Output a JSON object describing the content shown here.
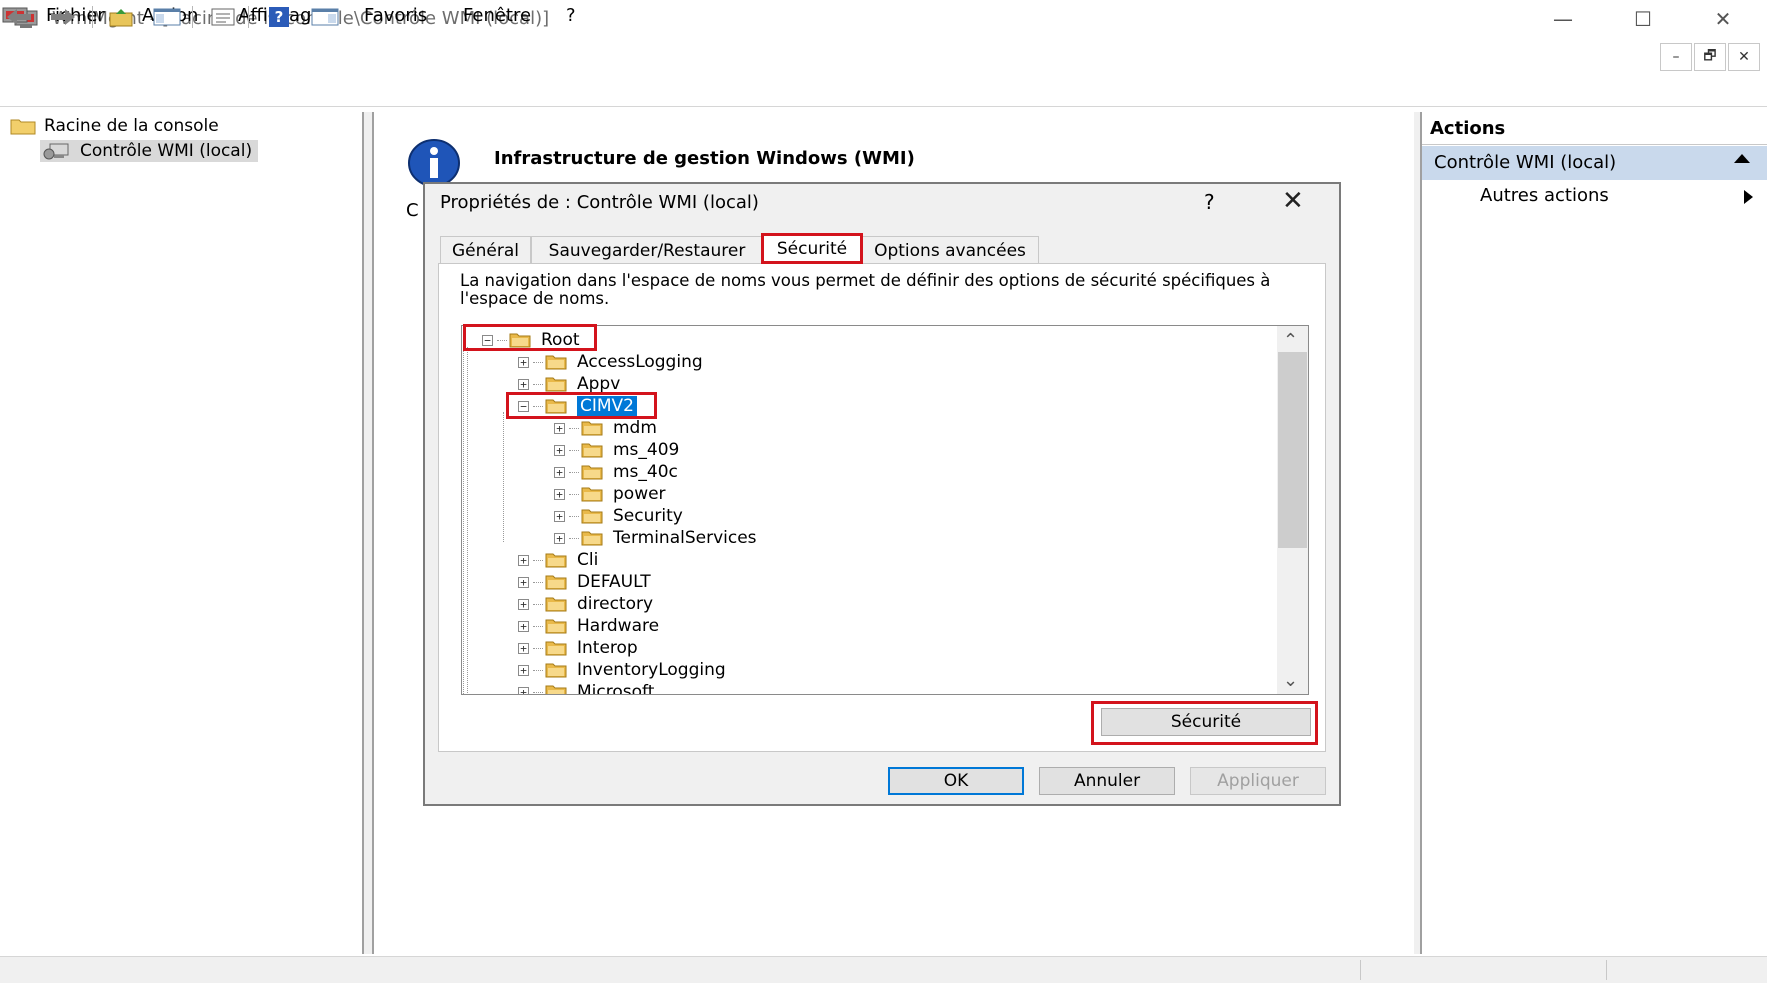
{
  "window": {
    "title": "WmiMgmt - [Racine de la console\\Contrôle WMI (local)]",
    "minimize": "—",
    "maximize": "☐",
    "close": "✕"
  },
  "menu": {
    "items": [
      "Fichier",
      "Action",
      "Affichage",
      "Favoris",
      "Fenêtre",
      "?"
    ],
    "mdi_min": "–",
    "mdi_restore": "🗗",
    "mdi_close": "✕"
  },
  "tree": {
    "root": "Racine de la console",
    "child": "Contrôle WMI (local)"
  },
  "center": {
    "title": "Infrastructure de gestion Windows (WMI)",
    "partial": "C"
  },
  "actions": {
    "title": "Actions",
    "selected": "Contrôle WMI (local)",
    "more": "Autres actions"
  },
  "dialog": {
    "title": "Propriétés de : Contrôle WMI (local)",
    "help": "?",
    "close": "✕",
    "tabs": [
      "Général",
      "Sauvegarder/Restaurer",
      "Sécurité",
      "Options avancées"
    ],
    "active_tab": "Sécurité",
    "description": "La navigation dans l'espace de noms vous permet de définir des options de sécurité spécifiques à l'espace de noms.",
    "namespaces": {
      "root": "Root",
      "level1_top": [
        "AccessLogging",
        "Appv"
      ],
      "selected": "CIMV2",
      "cimv2_children": [
        "mdm",
        "ms_409",
        "ms_40c",
        "power",
        "Security",
        "TerminalServices"
      ],
      "level1_bottom": [
        "Cli",
        "DEFAULT",
        "directory",
        "Hardware",
        "Interop",
        "InventoryLogging",
        "Microsoft"
      ]
    },
    "scroll_up": "⌃",
    "scroll_down": "⌄",
    "security_button": "Sécurité",
    "ok": "OK",
    "cancel": "Annuler",
    "apply": "Appliquer"
  },
  "colors": {
    "highlight_red": "#d3131c",
    "selection_blue": "#0078d7",
    "actions_selected": "#c9d9ec"
  }
}
